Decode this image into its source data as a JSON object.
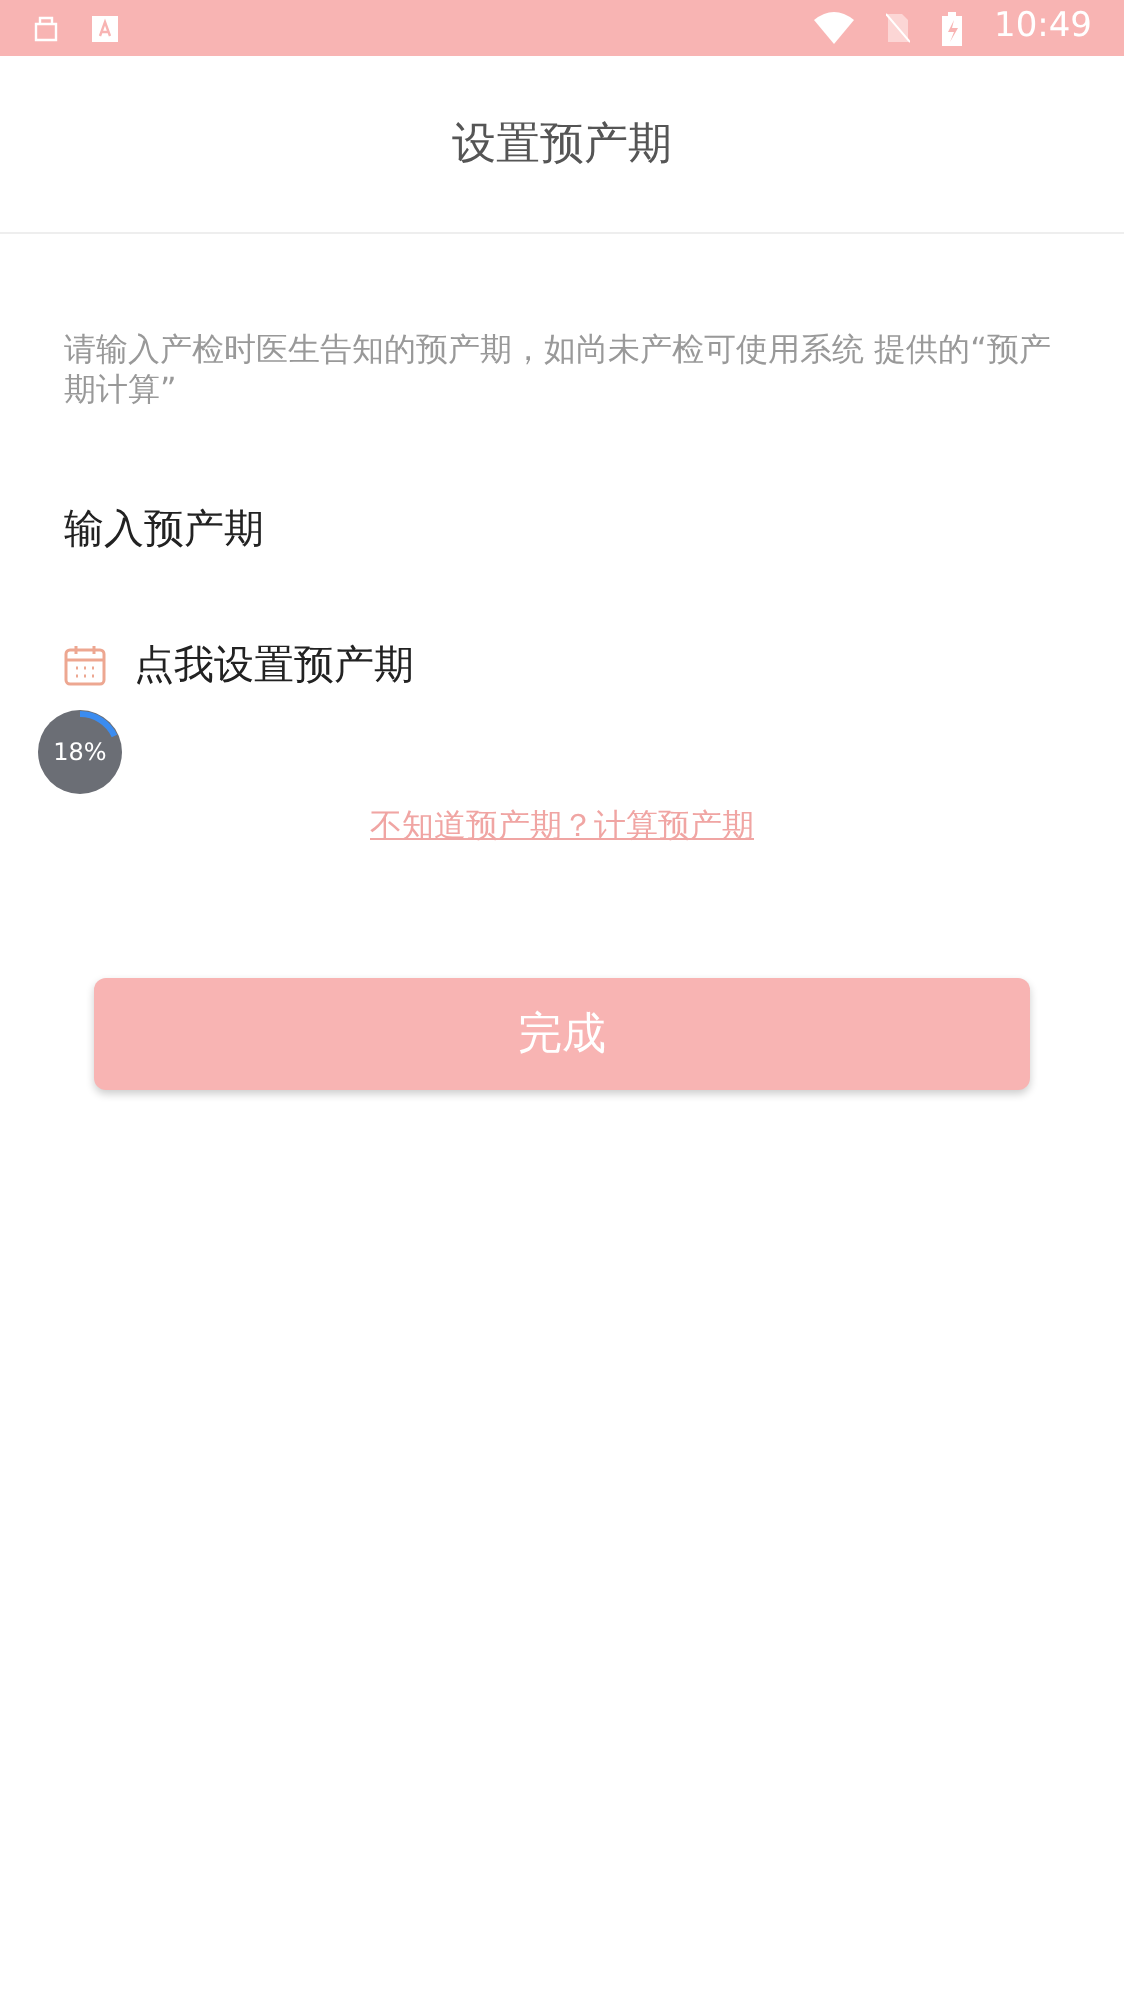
{
  "status_bar": {
    "time": "10:49"
  },
  "header": {
    "title": "设置预产期"
  },
  "hint": "请输入产检时医生告知的预产期，如尚未产检可使用系统 提供的“预产期计算”",
  "section_label": "输入预产期",
  "date_picker": {
    "placeholder": "点我设置预产期"
  },
  "floating_meter": {
    "reading": "18%",
    "level": 0.18
  },
  "calc_link": "不知道预产期？计算预产期",
  "done_button": {
    "label": "完成",
    "disabled": true
  }
}
